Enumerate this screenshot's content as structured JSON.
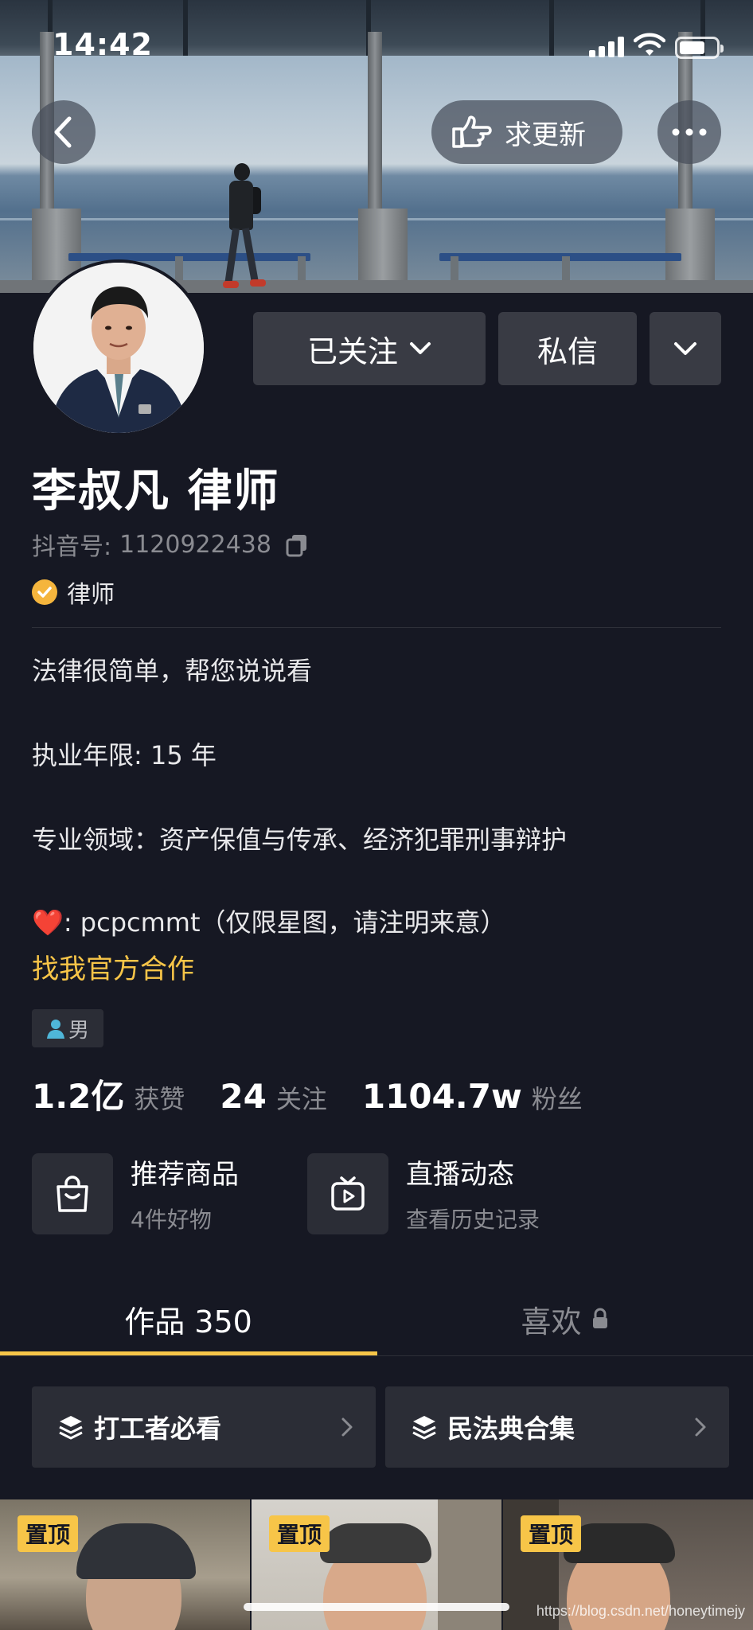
{
  "status_bar": {
    "time": "14:42",
    "battery_level": 0.7
  },
  "header": {
    "update_button_label": "求更新"
  },
  "profile": {
    "follow_label": "已关注",
    "message_label": "私信",
    "name": "李叔凡 律师",
    "douyin_id_label": "抖音号:",
    "douyin_id": "1120922438",
    "verification": "律师",
    "bio": {
      "line1": "法律很简单，帮您说说看",
      "line2": "执业年限: 15 年",
      "line3": "专业领域：资产保值与传承、经济犯罪刑事辩护",
      "line4_heart": "❤️",
      "line4": ": pcpcmmt（仅限星图，请注明来意）"
    },
    "cooperation_link": "找我官方合作",
    "gender": "男"
  },
  "stats": {
    "likes": {
      "value": "1.2亿",
      "label": "获赞"
    },
    "following": {
      "value": "24",
      "label": "关注"
    },
    "followers": {
      "value": "1104.7w",
      "label": "粉丝"
    }
  },
  "features": {
    "products": {
      "title": "推荐商品",
      "subtitle": "4件好物"
    },
    "live": {
      "title": "直播动态",
      "subtitle": "查看历史记录"
    }
  },
  "tabs": {
    "works": "作品 350",
    "likes": "喜欢"
  },
  "collections": [
    {
      "label": "打工者必看"
    },
    {
      "label": "民法典合集"
    }
  ],
  "videos": [
    {
      "badge": "置顶"
    },
    {
      "badge": "置顶"
    },
    {
      "badge": "置顶"
    }
  ],
  "watermark": "https://blog.csdn.net/honeytimejy",
  "colors": {
    "accent": "#f7c548",
    "background": "#161823",
    "button": "#393b44",
    "verified": "#f5b53d"
  }
}
